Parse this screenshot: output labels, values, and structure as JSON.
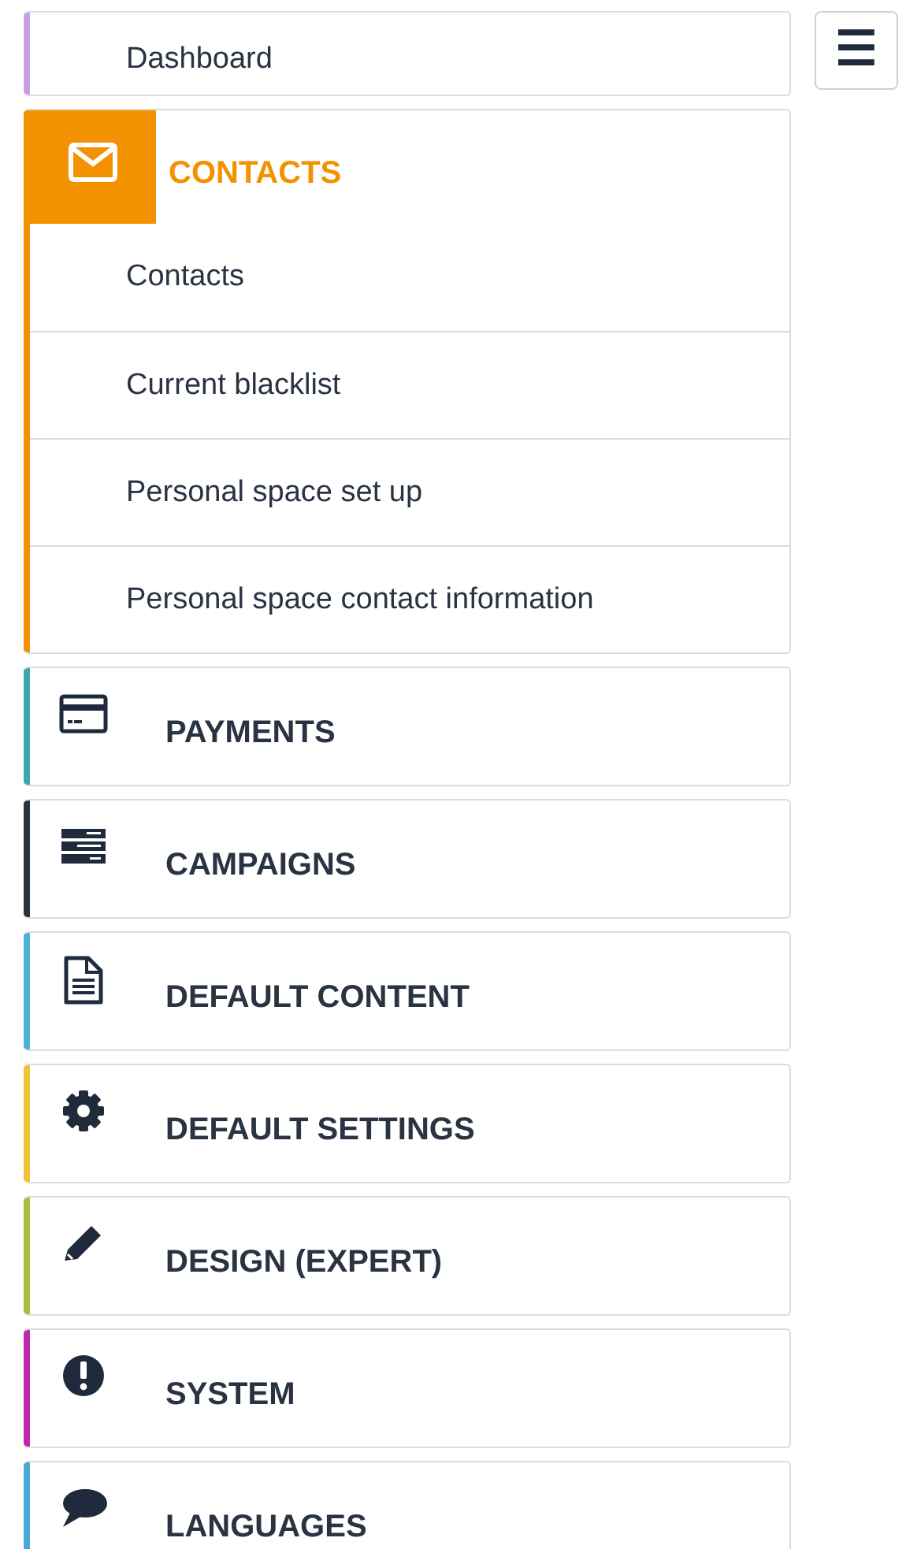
{
  "menu_button": {
    "label": "☰"
  },
  "sections": [
    {
      "kind": "link",
      "label": "Dashboard",
      "color": "#c9a0e6"
    },
    {
      "kind": "group",
      "label": "CONTACTS",
      "color": "#f39200",
      "expanded": true,
      "children": [
        {
          "label": "Contacts"
        },
        {
          "label": "Current blacklist"
        },
        {
          "label": "Personal space set up"
        },
        {
          "label": "Personal space contact information"
        }
      ]
    },
    {
      "kind": "group",
      "label": "PAYMENTS",
      "color": "#3fa7a9",
      "expanded": false
    },
    {
      "kind": "group",
      "label": "CAMPAIGNS",
      "color": "#2a3342",
      "expanded": false
    },
    {
      "kind": "group",
      "label": "DEFAULT CONTENT",
      "color": "#4bb3d8",
      "expanded": false
    },
    {
      "kind": "group",
      "label": "DEFAULT SETTINGS",
      "color": "#f2c037",
      "expanded": false
    },
    {
      "kind": "group",
      "label": "DESIGN (EXPERT)",
      "color": "#a5c03a",
      "expanded": false
    },
    {
      "kind": "group",
      "label": "SYSTEM",
      "color": "#c026b0",
      "expanded": false
    },
    {
      "kind": "group",
      "label": "LANGUAGES",
      "color": "#4aa8d8",
      "expanded": false
    }
  ]
}
